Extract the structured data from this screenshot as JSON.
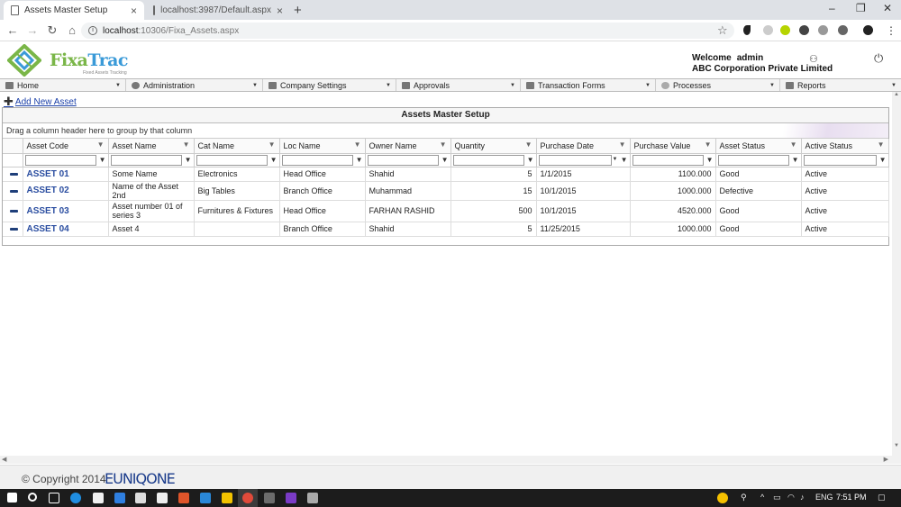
{
  "browser": {
    "tabs": [
      {
        "title": "Assets Master Setup",
        "active": true
      },
      {
        "title": "localhost:3987/Default.aspx",
        "active": false
      }
    ],
    "url_host": "localhost",
    "url_path": ":10306/Fixa_Assets.aspx"
  },
  "header": {
    "brand_part1": "Fixa",
    "brand_part2": "Trac",
    "tagline": "Fixed Assets Tracking",
    "welcome_label": "Welcome",
    "username": "admin",
    "company": "ABC Corporation Private Limited"
  },
  "menu": {
    "items": [
      {
        "label": "Home"
      },
      {
        "label": "Administration"
      },
      {
        "label": "Company Settings"
      },
      {
        "label": "Approvals"
      },
      {
        "label": "Transaction Forms"
      },
      {
        "label": "Processes"
      },
      {
        "label": "Reports"
      }
    ]
  },
  "actions": {
    "add_new_label": "Add New Asset"
  },
  "grid": {
    "title": "Assets Master Setup",
    "group_hint": "Drag a column header here to group by that column",
    "columns": [
      "Asset Code",
      "Asset Name",
      "Cat Name",
      "Loc Name",
      "Owner Name",
      "Quantity",
      "Purchase Date",
      "Purchase Value",
      "Asset Status",
      "Active Status"
    ],
    "rows": [
      {
        "code": "ASSET 01",
        "name": "Some Name",
        "cat": "Electronics",
        "loc": "Head Office",
        "owner": "Shahid",
        "qty": "5",
        "date": "1/1/2015",
        "value": "1100.000",
        "status": "Good",
        "active": "Active"
      },
      {
        "code": "ASSET 02",
        "name": "Name of the Asset 2nd",
        "cat": "Big Tables",
        "loc": "Branch Office",
        "owner": "Muhammad",
        "qty": "15",
        "date": "10/1/2015",
        "value": "1000.000",
        "status": "Defective",
        "active": "Active"
      },
      {
        "code": "ASSET 03",
        "name": "Asset number 01 of series 3",
        "cat": "Furnitures & Fixtures",
        "loc": "Head Office",
        "owner": "FARHAN RASHID",
        "qty": "500",
        "date": "10/1/2015",
        "value": "4520.000",
        "status": "Good",
        "active": "Active"
      },
      {
        "code": "ASSET 04",
        "name": "Asset 4",
        "cat": "",
        "loc": "Branch Office",
        "owner": "Shahid",
        "qty": "5",
        "date": "11/25/2015",
        "value": "1000.000",
        "status": "Good",
        "active": "Active"
      }
    ]
  },
  "footer": {
    "copyright": "© Copyright 2014",
    "brand": "EUNIQONE"
  },
  "taskbar": {
    "language": "ENG",
    "time": "7:51 PM"
  }
}
